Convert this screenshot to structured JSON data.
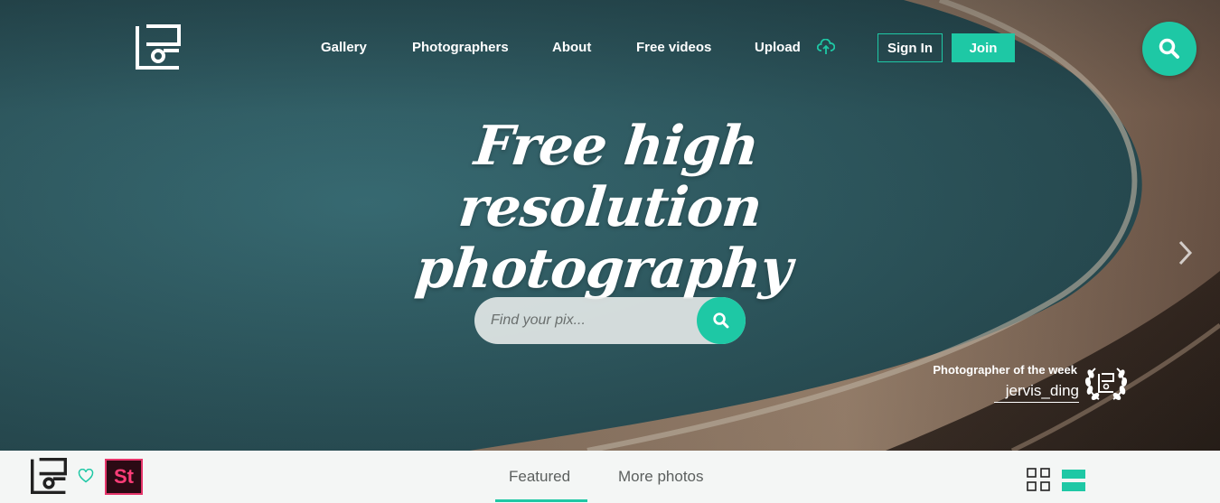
{
  "nav": {
    "items": [
      {
        "label": "Gallery"
      },
      {
        "label": "Photographers"
      },
      {
        "label": "About"
      },
      {
        "label": "Free videos"
      },
      {
        "label": "Upload"
      }
    ],
    "sign_in": "Sign In",
    "join": "Join"
  },
  "hero": {
    "headline_line1": "Free high resolution",
    "headline_line2": "photography",
    "search_placeholder": "Find your pix..."
  },
  "photographer_of_week": {
    "label": "Photographer of the week",
    "name": "jervis_ding"
  },
  "bottombar": {
    "stock_badge": "St",
    "tabs": [
      {
        "label": "Featured",
        "active": true
      },
      {
        "label": "More photos",
        "active": false
      }
    ]
  },
  "icons": {
    "logo": "pixabay-logo-icon",
    "upload": "cloud-upload-icon",
    "search": "search-icon",
    "next": "chevron-right-icon",
    "laurel": "laurel-wreath-icon",
    "heart": "heart-icon",
    "grid": "grid-view-icon",
    "list": "list-view-icon"
  },
  "colors": {
    "accent": "#1ec8a5",
    "stock_pink": "#ff3d78"
  }
}
